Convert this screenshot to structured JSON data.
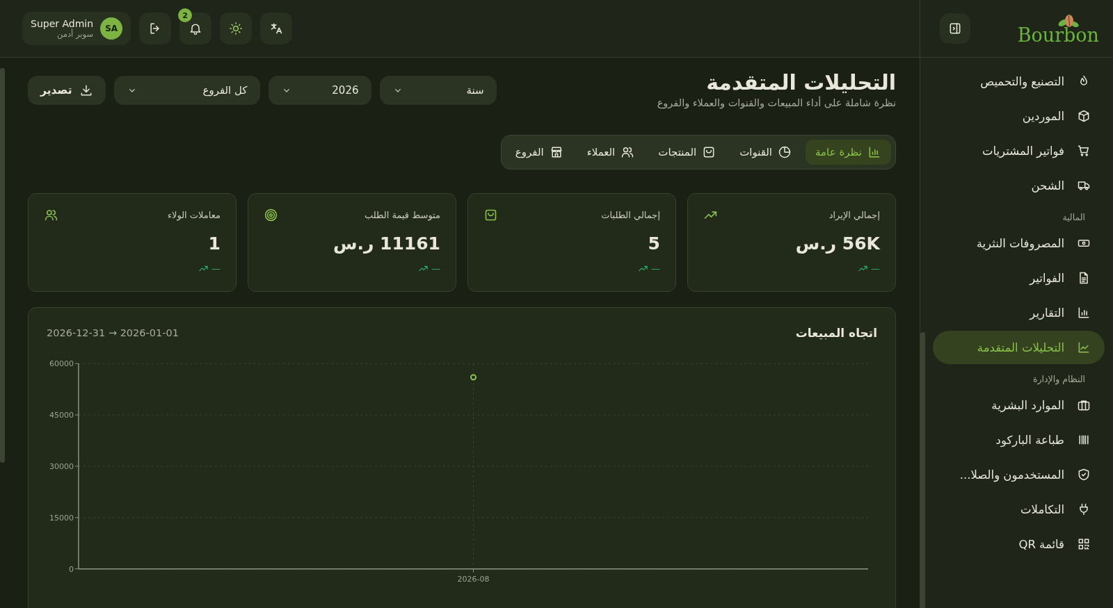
{
  "topbar": {
    "user": {
      "name": "Super Admin",
      "role": "سوبر أدمن",
      "initials": "SA"
    },
    "notifications": {
      "count": "2"
    }
  },
  "sidebar": {
    "logo": "Bourbon",
    "groups": [
      {
        "items": [
          {
            "label": "التصنيع والتحميص",
            "selected": false
          },
          {
            "label": "الموردين",
            "selected": false
          },
          {
            "label": "فواتير المشتريات",
            "selected": false
          },
          {
            "label": "الشحن",
            "selected": false
          }
        ]
      },
      {
        "heading": "المالية",
        "items": [
          {
            "label": "المصروفات النثرية",
            "selected": false
          },
          {
            "label": "الفواتير",
            "selected": false
          },
          {
            "label": "التقارير",
            "selected": false
          },
          {
            "label": "التحليلات المتقدمة",
            "selected": true
          }
        ]
      },
      {
        "heading": "النظام والإدارة",
        "items": [
          {
            "label": "الموارد البشرية",
            "selected": false
          },
          {
            "label": "طباعة الباركود",
            "selected": false
          },
          {
            "label": "المستخدمون والصلا...",
            "selected": false
          },
          {
            "label": "التكاملات",
            "selected": false
          },
          {
            "label": "قائمة QR",
            "selected": false
          }
        ]
      }
    ]
  },
  "page": {
    "title": "التحليلات المتقدمة",
    "subtitle": "نظرة شاملة على أداء المبيعات والقنوات والعملاء والفروع"
  },
  "filters": [
    {
      "value": "سنة"
    },
    {
      "value": "2026"
    },
    {
      "value": "كل الفروع"
    }
  ],
  "export_button": {
    "label": "تصدير"
  },
  "tabs": [
    {
      "label": "نظرة عامة",
      "selected": true
    },
    {
      "label": "القنوات",
      "selected": false
    },
    {
      "label": "المنتجات",
      "selected": false
    },
    {
      "label": "العملاء",
      "selected": false
    },
    {
      "label": "الفروع",
      "selected": false
    }
  ],
  "stats": [
    {
      "label": "إجمالي الإيراد",
      "value": "56K ر.س",
      "trend": "—"
    },
    {
      "label": "إجمالي الطلبات",
      "value": "5",
      "trend": "—"
    },
    {
      "label": "متوسط قيمة الطلب",
      "value": "11161 ر.س",
      "trend": "—"
    },
    {
      "label": "معاملات الولاء",
      "value": "1",
      "trend": "—"
    }
  ],
  "sales_trend": {
    "date_range": "2026-12-31 → 2026-01-01",
    "chart_data": {
      "type": "line",
      "title": "اتجاه المبيعات",
      "categories": [
        "2026-08"
      ],
      "series": [
        {
          "color": "#8bc34a",
          "marker": true,
          "values": [
            56000
          ]
        }
      ],
      "grid": true,
      "ylim": [
        0,
        60000
      ],
      "yticks": [
        0,
        15000,
        30000,
        45000,
        60000
      ]
    }
  }
}
